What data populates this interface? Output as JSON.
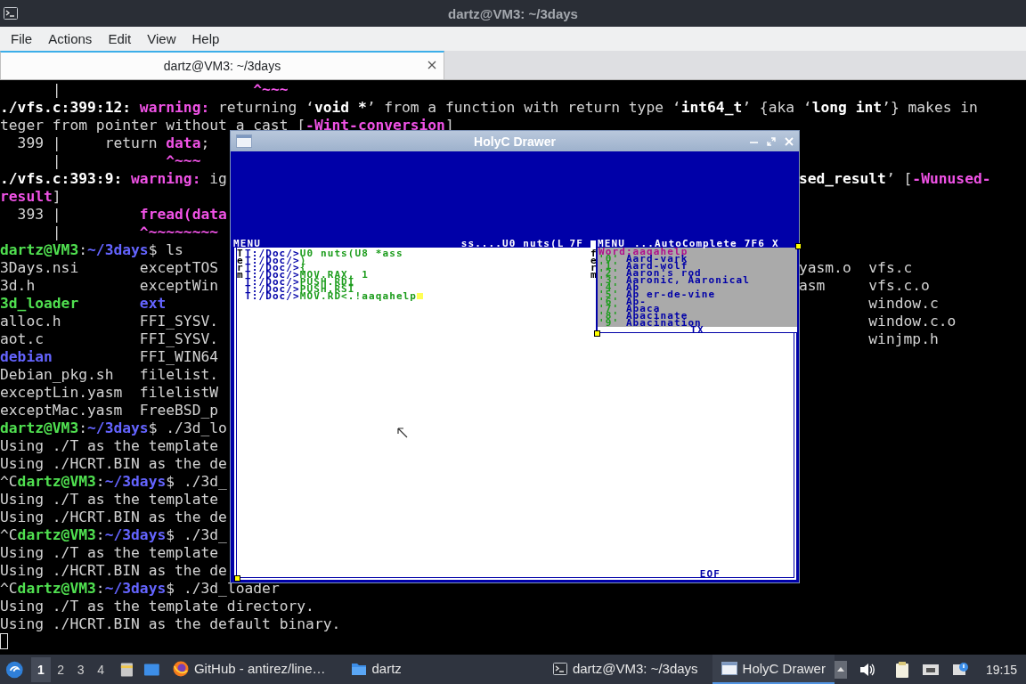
{
  "title_bar": {
    "title": "dartz@VM3: ~/3days"
  },
  "menu_bar": [
    "File",
    "Actions",
    "Edit",
    "View",
    "Help"
  ],
  "tabs": [
    {
      "label": "dartz@VM3: ~/3days",
      "selected": true
    }
  ],
  "terminal": {
    "cursor": true,
    "lines": [
      {
        "left": [
          {
            "text": "      |",
            "kind": "plain"
          },
          {
            "text": "                      ^~~~",
            "kind": "highlight"
          }
        ]
      },
      {
        "left": [
          {
            "text": "./vfs.c:399:12: ",
            "kind": "bold"
          },
          {
            "text": "warning:",
            "kind": "highlight"
          },
          {
            "text": " returning ‘",
            "kind": "plain"
          },
          {
            "text": "void *",
            "kind": "bold"
          },
          {
            "text": "’ from a function with return type ‘",
            "kind": "plain"
          },
          {
            "text": "int64_t",
            "kind": "bold"
          },
          {
            "text": "’ {aka ‘",
            "kind": "plain"
          },
          {
            "text": "long int",
            "kind": "bold"
          },
          {
            "text": "’} makes in",
            "kind": "plain"
          }
        ]
      },
      {
        "left": [
          {
            "text": "teger from pointer without a cast [",
            "kind": "plain"
          },
          {
            "text": "-Wint-conversion",
            "kind": "highlight"
          },
          {
            "text": "]",
            "kind": "plain"
          }
        ]
      },
      {
        "left": [
          {
            "text": "  399 |     return ",
            "kind": "plain"
          },
          {
            "text": "data",
            "kind": "highlight"
          },
          {
            "text": ";",
            "kind": "plain"
          }
        ]
      },
      {
        "left": [
          {
            "text": "      |",
            "kind": "plain"
          },
          {
            "text": "            ^~~~",
            "kind": "highlight"
          }
        ]
      },
      {
        "left": [
          {
            "text": "./vfs.c:393:9: ",
            "kind": "bold"
          },
          {
            "text": "warning:",
            "kind": "highlight"
          },
          {
            "text": " ig",
            "kind": "plain"
          }
        ],
        "right": [
          {
            "text": "sed_result",
            "kind": "bold"
          },
          {
            "text": "’ [",
            "kind": "plain"
          },
          {
            "text": "-Wunused-",
            "kind": "highlight"
          }
        ]
      },
      {
        "left": [
          {
            "text": "result",
            "kind": "highlight"
          },
          {
            "text": "]",
            "kind": "plain"
          }
        ]
      },
      {
        "left": [
          {
            "text": "  393 |",
            "kind": "plain"
          },
          {
            "text": "         fread(data",
            "kind": "highlight"
          }
        ]
      },
      {
        "left": [
          {
            "text": "      |",
            "kind": "plain"
          },
          {
            "text": "         ^~~~~~~~~",
            "kind": "highlight"
          }
        ]
      },
      {
        "left": [
          {
            "text": "dartz@VM3",
            "kind": "user"
          },
          {
            "text": ":",
            "kind": "plain"
          },
          {
            "text": "~/3days",
            "kind": "path"
          },
          {
            "text": "$ ls",
            "kind": "plain"
          }
        ]
      },
      {
        "left": [
          {
            "text": "3Days.nsi       exceptTOS",
            "kind": "plain"
          }
        ],
        "right": [
          {
            "text": "yasm.o  vfs.c",
            "kind": "plain"
          }
        ]
      },
      {
        "left": [
          {
            "text": "3d.h            exceptWin",
            "kind": "plain"
          }
        ],
        "right": [
          {
            "text": "asm     vfs.c.o",
            "kind": "plain"
          }
        ]
      },
      {
        "left": [
          {
            "text": "3d_loader",
            "kind": "executable"
          },
          {
            "text": "       ext",
            "kind": "directory"
          }
        ],
        "right": [
          {
            "text": "        window.c",
            "kind": "plain"
          }
        ]
      },
      {
        "left": [
          {
            "text": "alloc.h         FFI_SYSV.",
            "kind": "plain"
          }
        ],
        "right": [
          {
            "text": "        window.c.o",
            "kind": "plain"
          }
        ]
      },
      {
        "left": [
          {
            "text": "aot.c           FFI_SYSV.",
            "kind": "plain"
          }
        ],
        "right": [
          {
            "text": "        winjmp.h",
            "kind": "plain"
          }
        ]
      },
      {
        "left": [
          {
            "text": "debian",
            "kind": "directory"
          },
          {
            "text": "          FFI_WIN64",
            "kind": "plain"
          }
        ]
      },
      {
        "left": [
          {
            "text": "Debian_pkg.sh   filelist.",
            "kind": "plain"
          }
        ]
      },
      {
        "left": [
          {
            "text": "exceptLin.yasm  filelistW",
            "kind": "plain"
          }
        ]
      },
      {
        "left": [
          {
            "text": "exceptMac.yasm  FreeBSD_p",
            "kind": "plain"
          }
        ]
      },
      {
        "left": [
          {
            "text": "dartz@VM3",
            "kind": "user"
          },
          {
            "text": ":",
            "kind": "plain"
          },
          {
            "text": "~/3days",
            "kind": "path"
          },
          {
            "text": "$ ./3d_lo",
            "kind": "plain"
          }
        ]
      },
      {
        "left": [
          {
            "text": "Using ./T as the template",
            "kind": "plain"
          }
        ]
      },
      {
        "left": [
          {
            "text": "Using ./HCRT.BIN as the de",
            "kind": "plain"
          }
        ]
      },
      {
        "left": [
          {
            "text": "^C",
            "kind": "plain"
          },
          {
            "text": "dartz@VM3",
            "kind": "user"
          },
          {
            "text": ":",
            "kind": "plain"
          },
          {
            "text": "~/3days",
            "kind": "path"
          },
          {
            "text": "$ ./3d_",
            "kind": "plain"
          }
        ]
      },
      {
        "left": [
          {
            "text": "Using ./T as the template",
            "kind": "plain"
          }
        ]
      },
      {
        "left": [
          {
            "text": "Using ./HCRT.BIN as the de",
            "kind": "plain"
          }
        ]
      },
      {
        "left": [
          {
            "text": "^C",
            "kind": "plain"
          },
          {
            "text": "dartz@VM3",
            "kind": "user"
          },
          {
            "text": ":",
            "kind": "plain"
          },
          {
            "text": "~/3days",
            "kind": "path"
          },
          {
            "text": "$ ./3d_",
            "kind": "plain"
          }
        ]
      },
      {
        "left": [
          {
            "text": "Using ./T as the template",
            "kind": "plain"
          }
        ]
      },
      {
        "left": [
          {
            "text": "Using ./HCRT.BIN as the de",
            "kind": "plain"
          }
        ]
      },
      {
        "left": [
          {
            "text": "^C",
            "kind": "plain"
          },
          {
            "text": "dartz@VM3",
            "kind": "user"
          },
          {
            "text": ":",
            "kind": "plain"
          },
          {
            "text": "~/3days",
            "kind": "path"
          },
          {
            "text": "$ ./3d_loader",
            "kind": "plain"
          }
        ]
      },
      {
        "left": [
          {
            "text": "Using ./T as the template directory.",
            "kind": "plain"
          }
        ]
      },
      {
        "left": [
          {
            "text": "Using ./HCRT.BIN as the default binary.",
            "kind": "plain"
          }
        ]
      }
    ]
  },
  "holyc_window": {
    "title": "HolyC Drawer",
    "editor": {
      "header_left": "MENU",
      "header_right": [
        "ss....U0 nuts(L",
        "7F"
      ],
      "side_label": "Term",
      "cursor": true,
      "footer": "EOF",
      "lines": [
        {
          "prompt": "T:/Doc/>",
          "code": "U0 nuts(U8 *ass"
        },
        {
          "prompt": "T:/Doc/>",
          "code": ")"
        },
        {
          "prompt": "T:/Doc/>",
          "code": "{"
        },
        {
          "prompt": "T:/Doc/>",
          "code": "MOV.RAX, 1"
        },
        {
          "prompt": "T:/Doc/>",
          "code": "PUSH.RDI"
        },
        {
          "prompt": "T:/Doc/>",
          "code": "PUSH.RSI"
        },
        {
          "prompt": "T:/Doc/>",
          "code": "MOV.RD<.!aaqahelp"
        }
      ]
    },
    "autocomplete": {
      "header": [
        "MENU",
        "...AutoComplete",
        "7F6",
        "X"
      ],
      "side_label": "ferm",
      "word": "Word:aaqahelp",
      "footer": "TX",
      "items": [
        {
          "key": "'0'",
          "word": "Aard-vark"
        },
        {
          "key": "'1'",
          "word": "Aard-wolf"
        },
        {
          "key": "'2'",
          "word": "Aaron's rod"
        },
        {
          "key": "'3'",
          "word": "Aaronic, Aaronical"
        },
        {
          "key": "'4'",
          "word": "Ab"
        },
        {
          "key": "'5'",
          "word": "Ab er-de-vine"
        },
        {
          "key": "'6'",
          "word": "Ab-"
        },
        {
          "key": "'7'",
          "word": "Abaca"
        },
        {
          "key": "'8'",
          "word": "Abacinate"
        },
        {
          "key": "'9'",
          "word": "Abacination"
        }
      ]
    }
  },
  "taskbar": {
    "workspaces": [
      {
        "label": "1",
        "selected": true
      },
      {
        "label": "2",
        "selected": false
      },
      {
        "label": "3",
        "selected": false
      },
      {
        "label": "4",
        "selected": false
      }
    ],
    "tasks": [
      {
        "label": "GitHub - antirez/line…",
        "kind": "browser",
        "selected": false
      },
      {
        "label": "dartz",
        "kind": "folder",
        "selected": false
      },
      {
        "label": "dartz@VM3: ~/3days",
        "kind": "terminal",
        "selected": false
      },
      {
        "label": "HolyC Drawer",
        "kind": "window",
        "selected": true
      }
    ],
    "clock": "19:15"
  }
}
